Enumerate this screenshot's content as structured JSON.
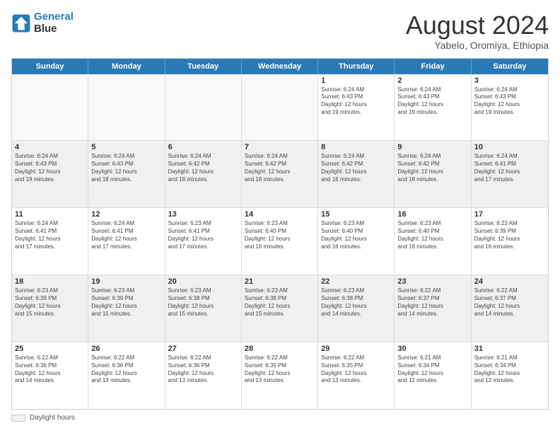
{
  "logo": {
    "line1": "General",
    "line2": "Blue"
  },
  "title": "August 2024",
  "subtitle": "Yabelo, Oromiya, Ethiopia",
  "days_of_week": [
    "Sunday",
    "Monday",
    "Tuesday",
    "Wednesday",
    "Thursday",
    "Friday",
    "Saturday"
  ],
  "footer_label": "Daylight hours",
  "weeks": [
    [
      {
        "day": "",
        "info": "",
        "empty": true
      },
      {
        "day": "",
        "info": "",
        "empty": true
      },
      {
        "day": "",
        "info": "",
        "empty": true
      },
      {
        "day": "",
        "info": "",
        "empty": true
      },
      {
        "day": "1",
        "info": "Sunrise: 6:24 AM\nSunset: 6:43 PM\nDaylight: 12 hours\nand 19 minutes.",
        "empty": false
      },
      {
        "day": "2",
        "info": "Sunrise: 6:24 AM\nSunset: 6:43 PM\nDaylight: 12 hours\nand 19 minutes.",
        "empty": false
      },
      {
        "day": "3",
        "info": "Sunrise: 6:24 AM\nSunset: 6:43 PM\nDaylight: 12 hours\nand 19 minutes.",
        "empty": false
      }
    ],
    [
      {
        "day": "4",
        "info": "Sunrise: 6:24 AM\nSunset: 6:43 PM\nDaylight: 12 hours\nand 19 minutes.",
        "empty": false
      },
      {
        "day": "5",
        "info": "Sunrise: 6:24 AM\nSunset: 6:43 PM\nDaylight: 12 hours\nand 18 minutes.",
        "empty": false
      },
      {
        "day": "6",
        "info": "Sunrise: 6:24 AM\nSunset: 6:42 PM\nDaylight: 12 hours\nand 18 minutes.",
        "empty": false
      },
      {
        "day": "7",
        "info": "Sunrise: 6:24 AM\nSunset: 6:42 PM\nDaylight: 12 hours\nand 18 minutes.",
        "empty": false
      },
      {
        "day": "8",
        "info": "Sunrise: 6:24 AM\nSunset: 6:42 PM\nDaylight: 12 hours\nand 18 minutes.",
        "empty": false
      },
      {
        "day": "9",
        "info": "Sunrise: 6:24 AM\nSunset: 6:42 PM\nDaylight: 12 hours\nand 18 minutes.",
        "empty": false
      },
      {
        "day": "10",
        "info": "Sunrise: 6:24 AM\nSunset: 6:41 PM\nDaylight: 12 hours\nand 17 minutes.",
        "empty": false
      }
    ],
    [
      {
        "day": "11",
        "info": "Sunrise: 6:24 AM\nSunset: 6:41 PM\nDaylight: 12 hours\nand 17 minutes.",
        "empty": false
      },
      {
        "day": "12",
        "info": "Sunrise: 6:24 AM\nSunset: 6:41 PM\nDaylight: 12 hours\nand 17 minutes.",
        "empty": false
      },
      {
        "day": "13",
        "info": "Sunrise: 6:23 AM\nSunset: 6:41 PM\nDaylight: 12 hours\nand 17 minutes.",
        "empty": false
      },
      {
        "day": "14",
        "info": "Sunrise: 6:23 AM\nSunset: 6:40 PM\nDaylight: 12 hours\nand 16 minutes.",
        "empty": false
      },
      {
        "day": "15",
        "info": "Sunrise: 6:23 AM\nSunset: 6:40 PM\nDaylight: 12 hours\nand 16 minutes.",
        "empty": false
      },
      {
        "day": "16",
        "info": "Sunrise: 6:23 AM\nSunset: 6:40 PM\nDaylight: 12 hours\nand 16 minutes.",
        "empty": false
      },
      {
        "day": "17",
        "info": "Sunrise: 6:23 AM\nSunset: 6:39 PM\nDaylight: 12 hours\nand 16 minutes.",
        "empty": false
      }
    ],
    [
      {
        "day": "18",
        "info": "Sunrise: 6:23 AM\nSunset: 6:39 PM\nDaylight: 12 hours\nand 15 minutes.",
        "empty": false
      },
      {
        "day": "19",
        "info": "Sunrise: 6:23 AM\nSunset: 6:39 PM\nDaylight: 12 hours\nand 15 minutes.",
        "empty": false
      },
      {
        "day": "20",
        "info": "Sunrise: 6:23 AM\nSunset: 6:38 PM\nDaylight: 12 hours\nand 15 minutes.",
        "empty": false
      },
      {
        "day": "21",
        "info": "Sunrise: 6:23 AM\nSunset: 6:38 PM\nDaylight: 12 hours\nand 15 minutes.",
        "empty": false
      },
      {
        "day": "22",
        "info": "Sunrise: 6:23 AM\nSunset: 6:38 PM\nDaylight: 12 hours\nand 14 minutes.",
        "empty": false
      },
      {
        "day": "23",
        "info": "Sunrise: 6:22 AM\nSunset: 6:37 PM\nDaylight: 12 hours\nand 14 minutes.",
        "empty": false
      },
      {
        "day": "24",
        "info": "Sunrise: 6:22 AM\nSunset: 6:37 PM\nDaylight: 12 hours\nand 14 minutes.",
        "empty": false
      }
    ],
    [
      {
        "day": "25",
        "info": "Sunrise: 6:22 AM\nSunset: 6:36 PM\nDaylight: 12 hours\nand 14 minutes.",
        "empty": false
      },
      {
        "day": "26",
        "info": "Sunrise: 6:22 AM\nSunset: 6:36 PM\nDaylight: 12 hours\nand 13 minutes.",
        "empty": false
      },
      {
        "day": "27",
        "info": "Sunrise: 6:22 AM\nSunset: 6:36 PM\nDaylight: 12 hours\nand 13 minutes.",
        "empty": false
      },
      {
        "day": "28",
        "info": "Sunrise: 6:22 AM\nSunset: 6:35 PM\nDaylight: 12 hours\nand 13 minutes.",
        "empty": false
      },
      {
        "day": "29",
        "info": "Sunrise: 6:22 AM\nSunset: 6:35 PM\nDaylight: 12 hours\nand 13 minutes.",
        "empty": false
      },
      {
        "day": "30",
        "info": "Sunrise: 6:21 AM\nSunset: 6:34 PM\nDaylight: 12 hours\nand 12 minutes.",
        "empty": false
      },
      {
        "day": "31",
        "info": "Sunrise: 6:21 AM\nSunset: 6:34 PM\nDaylight: 12 hours\nand 12 minutes.",
        "empty": false
      }
    ]
  ]
}
